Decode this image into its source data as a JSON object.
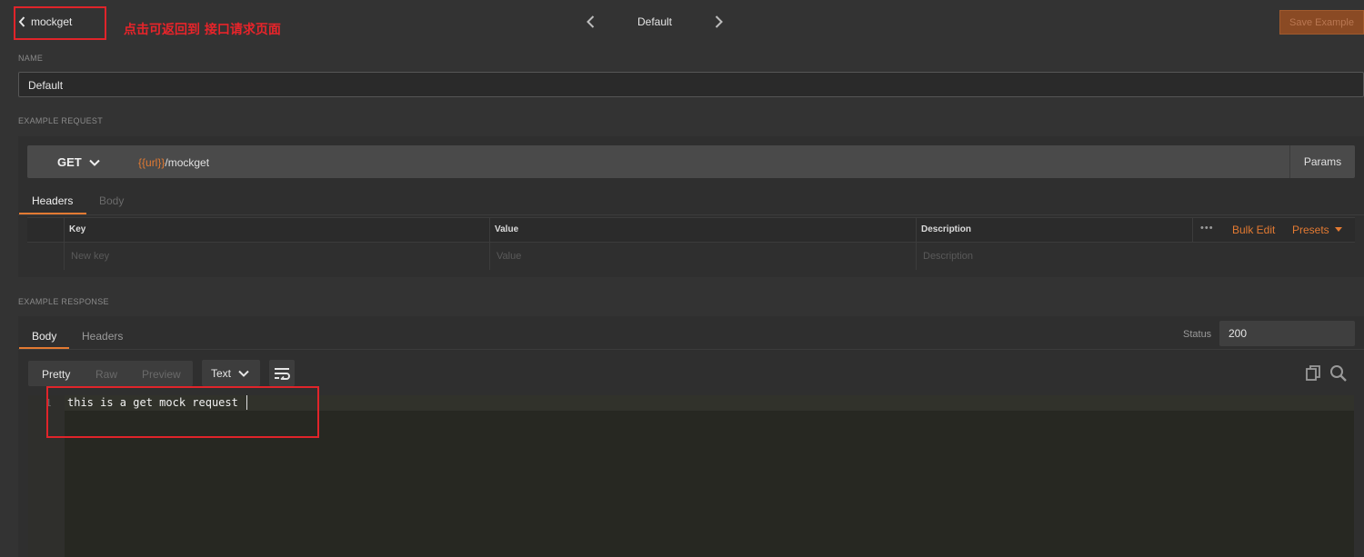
{
  "header": {
    "back_label": "mockget",
    "annotation_top": "点击可返回到 接口请求页面",
    "example_name": "Default",
    "save_label": "Save Example"
  },
  "name_section": {
    "label": "NAME",
    "value": "Default"
  },
  "request_section": {
    "label": "EXAMPLE REQUEST",
    "method": "GET",
    "url_variable": "{{url}}",
    "url_path": "/mockget",
    "params_label": "Params",
    "tabs": [
      {
        "label": "Headers",
        "active": true
      },
      {
        "label": "Body",
        "active": false
      }
    ],
    "columns": {
      "key": "Key",
      "value": "Value",
      "description": "Description"
    },
    "placeholders": {
      "key": "New key",
      "value": "Value",
      "description": "Description"
    },
    "more_label": "•••",
    "bulk_edit_label": "Bulk Edit",
    "presets_label": "Presets"
  },
  "response_section": {
    "label": "EXAMPLE RESPONSE",
    "tabs": [
      {
        "label": "Body",
        "active": true
      },
      {
        "label": "Headers",
        "active": false
      }
    ],
    "status_label": "Status",
    "status_value": "200",
    "formats": [
      "Pretty",
      "Raw",
      "Preview"
    ],
    "active_format": "Pretty",
    "type_value": "Text",
    "code_lines": [
      {
        "num": "1",
        "text": "this is a get mock request"
      }
    ]
  },
  "colors": {
    "accent": "#e37a32",
    "annotation": "#e0242a",
    "background": "#333333",
    "editor_bg": "#272822"
  },
  "icons": [
    "chevron-left-icon",
    "chevron-right-icon",
    "chevron-down-icon",
    "wrap-lines-icon",
    "copy-icon",
    "search-icon"
  ]
}
